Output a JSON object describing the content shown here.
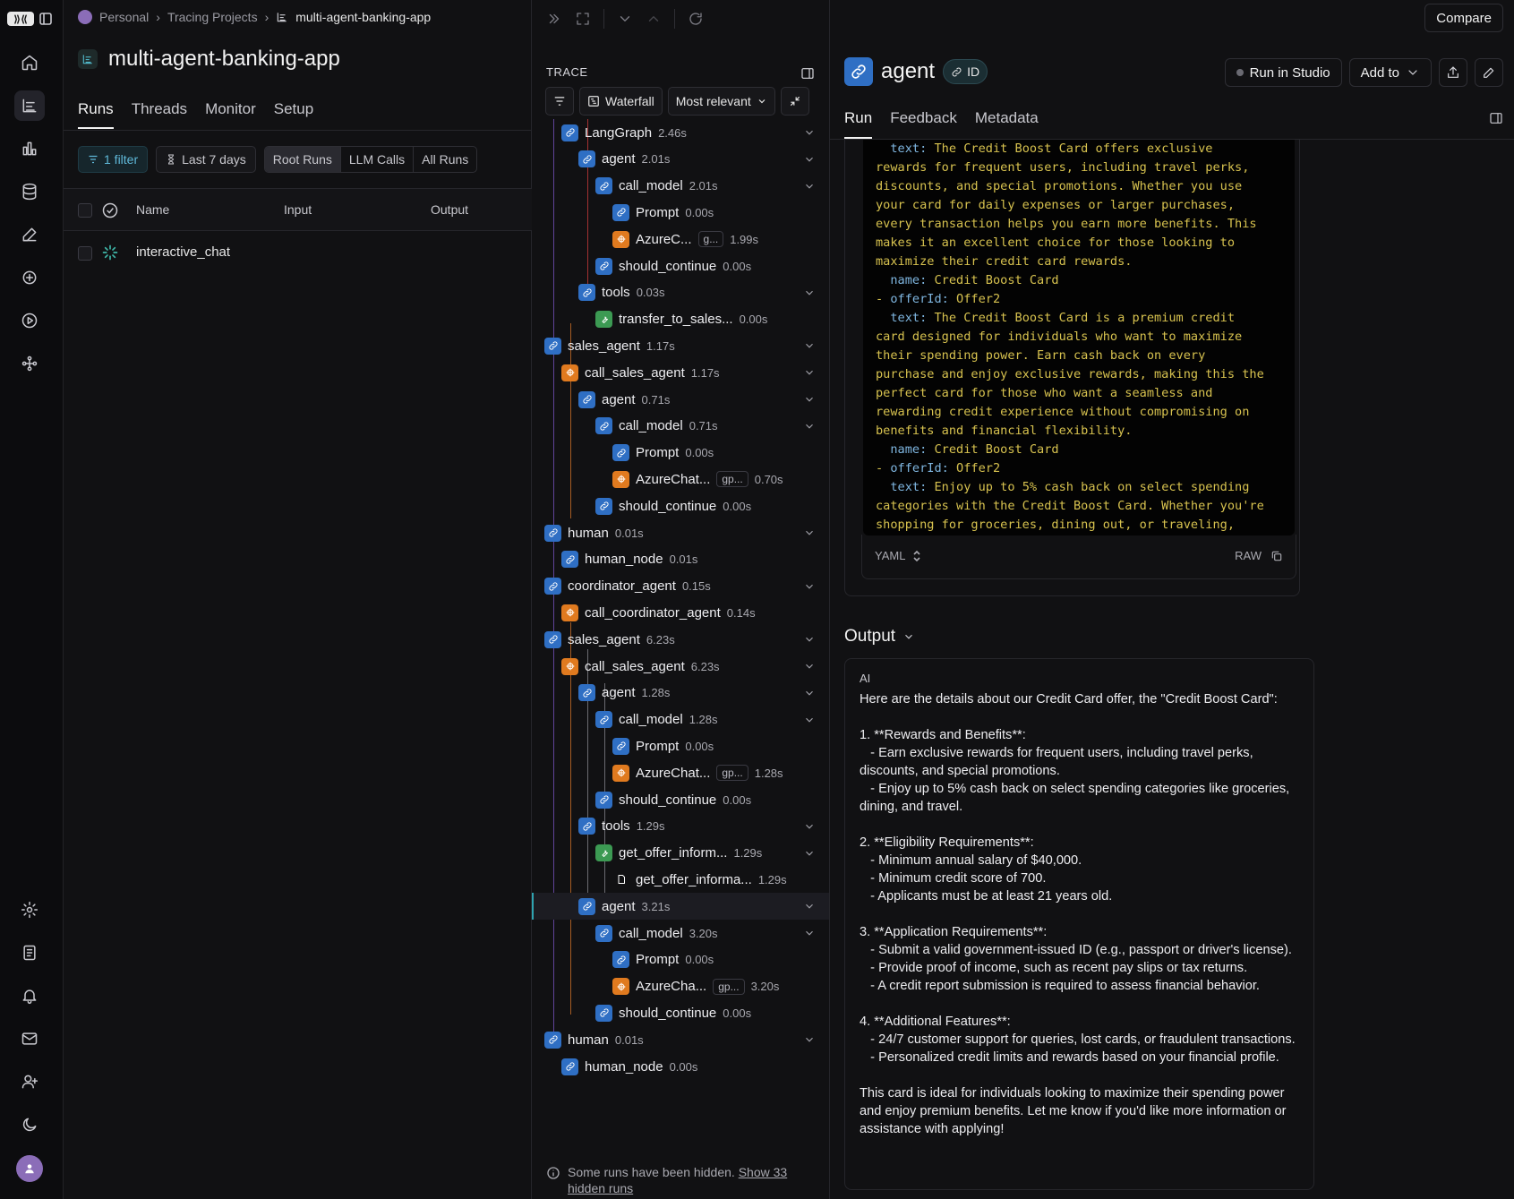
{
  "breadcrumb": {
    "items": [
      "Personal",
      "Tracing Projects",
      "multi-agent-banking-app"
    ]
  },
  "project": {
    "title": "multi-agent-banking-app",
    "tabs": [
      "Runs",
      "Threads",
      "Monitor",
      "Setup"
    ],
    "active_tab": "Runs",
    "filters": {
      "filter_chip": "1 filter",
      "date_chip": "Last 7 days",
      "segments": [
        "Root Runs",
        "LLM Calls",
        "All Runs"
      ],
      "active_segment": "Root Runs"
    },
    "table": {
      "columns": [
        "Name",
        "Input",
        "Output"
      ],
      "rows": [
        {
          "name": "interactive_chat"
        }
      ]
    }
  },
  "trace": {
    "label": "TRACE",
    "view_mode": "Waterfall",
    "sort": "Most relevant",
    "nodes": [
      {
        "name": "LangGraph",
        "latency": "2.46s",
        "type": "chain"
      },
      {
        "name": "agent",
        "latency": "2.01s",
        "type": "chain"
      },
      {
        "name": "call_model",
        "latency": "2.01s",
        "type": "chain"
      },
      {
        "name": "Prompt",
        "latency": "0.00s",
        "type": "chain"
      },
      {
        "name": "AzureC...",
        "tag": "g...",
        "latency": "1.99s",
        "type": "llm"
      },
      {
        "name": "should_continue",
        "latency": "0.00s",
        "type": "chain"
      },
      {
        "name": "tools",
        "latency": "0.03s",
        "type": "chain"
      },
      {
        "name": "transfer_to_sales...",
        "latency": "0.00s",
        "type": "tool"
      },
      {
        "name": "sales_agent",
        "latency": "1.17s",
        "type": "chain"
      },
      {
        "name": "call_sales_agent",
        "latency": "1.17s",
        "type": "llm"
      },
      {
        "name": "agent",
        "latency": "0.71s",
        "type": "chain"
      },
      {
        "name": "call_model",
        "latency": "0.71s",
        "type": "chain"
      },
      {
        "name": "Prompt",
        "latency": "0.00s",
        "type": "chain"
      },
      {
        "name": "AzureChat...",
        "tag": "gp...",
        "latency": "0.70s",
        "type": "llm"
      },
      {
        "name": "should_continue",
        "latency": "0.00s",
        "type": "chain"
      },
      {
        "name": "human",
        "latency": "0.01s",
        "type": "chain"
      },
      {
        "name": "human_node",
        "latency": "0.01s",
        "type": "chain"
      },
      {
        "name": "coordinator_agent",
        "latency": "0.15s",
        "type": "chain"
      },
      {
        "name": "call_coordinator_agent",
        "latency": "0.14s",
        "type": "llm"
      },
      {
        "name": "sales_agent",
        "latency": "6.23s",
        "type": "chain"
      },
      {
        "name": "call_sales_agent",
        "latency": "6.23s",
        "type": "llm"
      },
      {
        "name": "agent",
        "latency": "1.28s",
        "type": "chain"
      },
      {
        "name": "call_model",
        "latency": "1.28s",
        "type": "chain"
      },
      {
        "name": "Prompt",
        "latency": "0.00s",
        "type": "chain"
      },
      {
        "name": "AzureChat...",
        "tag": "gp...",
        "latency": "1.28s",
        "type": "llm"
      },
      {
        "name": "should_continue",
        "latency": "0.00s",
        "type": "chain"
      },
      {
        "name": "tools",
        "latency": "1.29s",
        "type": "chain"
      },
      {
        "name": "get_offer_inform...",
        "latency": "1.29s",
        "type": "tool"
      },
      {
        "name": "get_offer_informa...",
        "latency": "1.29s",
        "type": "retriever"
      },
      {
        "name": "agent",
        "latency": "3.21s",
        "type": "chain"
      },
      {
        "name": "call_model",
        "latency": "3.20s",
        "type": "chain"
      },
      {
        "name": "Prompt",
        "latency": "0.00s",
        "type": "chain"
      },
      {
        "name": "AzureCha...",
        "tag": "gp...",
        "latency": "3.20s",
        "type": "llm"
      },
      {
        "name": "should_continue",
        "latency": "0.00s",
        "type": "chain"
      },
      {
        "name": "human",
        "latency": "0.01s",
        "type": "chain"
      },
      {
        "name": "human_node",
        "latency": "0.00s",
        "type": "chain"
      }
    ],
    "hidden_note": "Some runs have been hidden.",
    "hidden_link": "Show 33 hidden runs"
  },
  "detail": {
    "compare_label": "Compare",
    "run_name": "agent",
    "id_label": "ID",
    "run_in_studio": "Run in Studio",
    "add_to": "Add to",
    "tabs": [
      "Run",
      "Feedback",
      "Metadata"
    ],
    "active_tab": "Run",
    "input_yaml_lines": [
      "  text: The Credit Boost Card offers exclusive",
      "rewards for frequent users, including travel perks,",
      "discounts, and special promotions. Whether you use",
      "your card for daily expenses or larger purchases,",
      "every transaction helps you earn more benefits. This",
      "makes it an excellent choice for those looking to",
      "maximize their credit card rewards.",
      "  name: Credit Boost Card",
      "- offerId: Offer2",
      "  text: The Credit Boost Card is a premium credit",
      "card designed for individuals who want to maximize",
      "their spending power. Earn cash back on every",
      "purchase and enjoy exclusive rewards, making this the",
      "perfect card for those who want a seamless and",
      "rewarding credit experience without compromising on",
      "benefits and financial flexibility.",
      "  name: Credit Boost Card",
      "- offerId: Offer2",
      "  text: Enjoy up to 5% cash back on select spending",
      "categories with the Credit Boost Card. Whether you're",
      "shopping for groceries, dining out, or traveling,"
    ],
    "format_label": "YAML",
    "raw_label": "RAW",
    "output_title": "Output",
    "output_role": "AI",
    "output_text": "Here are the details about our Credit Card offer, the \"Credit Boost Card\":\n\n1. **Rewards and Benefits**:\n   - Earn exclusive rewards for frequent users, including travel perks, discounts, and special promotions.\n   - Enjoy up to 5% cash back on select spending categories like groceries, dining, and travel.\n\n2. **Eligibility Requirements**:\n   - Minimum annual salary of $40,000.\n   - Minimum credit score of 700.\n   - Applicants must be at least 21 years old.\n\n3. **Application Requirements**:\n   - Submit a valid government-issued ID (e.g., passport or driver's license).\n   - Provide proof of income, such as recent pay slips or tax returns.\n   - A credit report submission is required to assess financial behavior.\n\n4. **Additional Features**:\n   - 24/7 customer support for queries, lost cards, or fraudulent transactions.\n   - Personalized credit limits and rewards based on your financial profile.\n\nThis card is ideal for individuals looking to maximize their spending power and enjoy premium benefits. Let me know if you'd like more information or assistance with applying!"
  },
  "colors": {
    "chain": "#2f6fc4",
    "llm": "#e07a1f",
    "tool": "#3c9a53",
    "retriever": "#d0508c",
    "accent": "#2fa3b0",
    "yaml_text": "#d7c24f"
  }
}
